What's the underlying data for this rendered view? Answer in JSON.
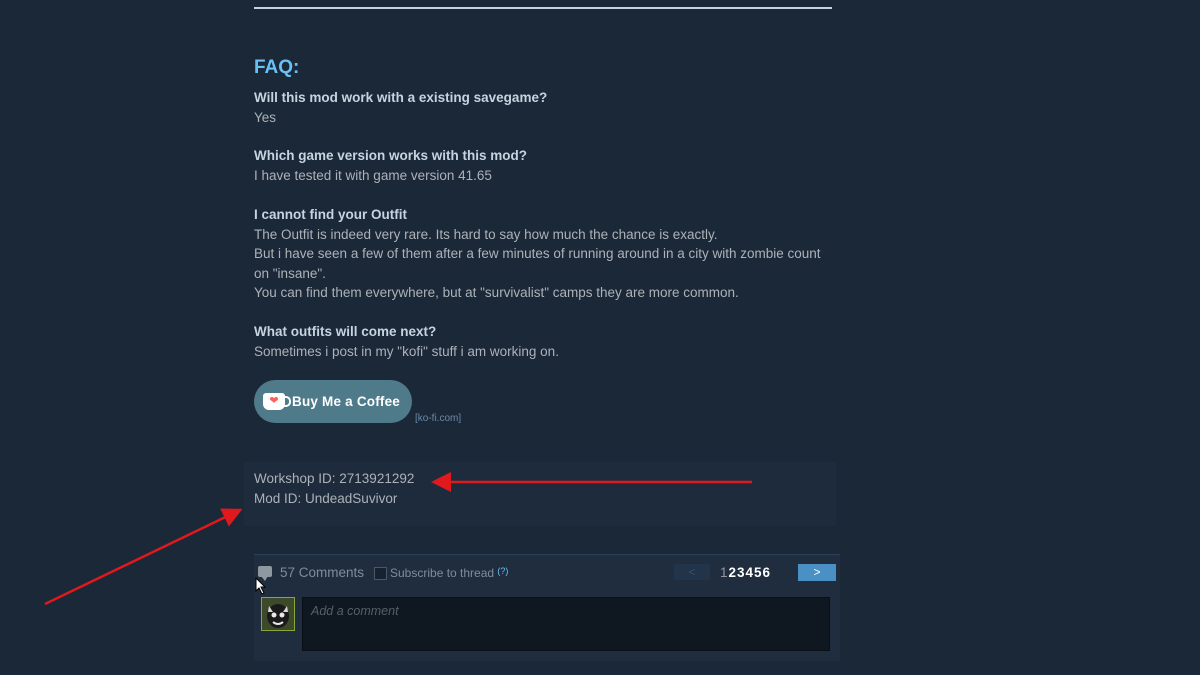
{
  "faq": {
    "title": "FAQ:",
    "items": [
      {
        "question": "Will this mod work with a existing savegame?",
        "answer": [
          "Yes"
        ]
      },
      {
        "question": "Which game version works with this mod?",
        "answer": [
          "I have tested it with game version 41.65"
        ]
      },
      {
        "question": "I cannot find your Outfit",
        "answer": [
          "The Outfit is indeed very rare. Its hard to say how much the chance is exactly.",
          "But i have seen a few of them after a few minutes of running around in a city with zombie count",
          "on \"insane\".",
          "You can find them everywhere, but at \"survivalist\" camps they are more common."
        ]
      },
      {
        "question": "What outfits will come next?",
        "answer": [
          "Sometimes i post in my \"kofi\" stuff i am working on."
        ]
      }
    ]
  },
  "kofi": {
    "button_label": "Buy Me a Coffee",
    "domain": "[ko-fi.com]"
  },
  "mod_info": {
    "workshop_id": "Workshop ID: 2713921292",
    "mod_id": "Mod ID: UndeadSuvivor"
  },
  "comments": {
    "count_label": "57 Comments",
    "subscribe_label": "Subscribe to thread",
    "subscribe_help": "(?)",
    "prev_label": "<",
    "current_page": "1",
    "other_pages": "23456",
    "next_label": ">",
    "input_placeholder": "Add a comment"
  },
  "colors": {
    "background": "#1b2838",
    "accent": "#67c1f5",
    "annotation_arrow": "#e0191c"
  },
  "icons": [
    "comment-bubble-icon",
    "coffee-cup-icon",
    "mouse-cursor-icon"
  ]
}
